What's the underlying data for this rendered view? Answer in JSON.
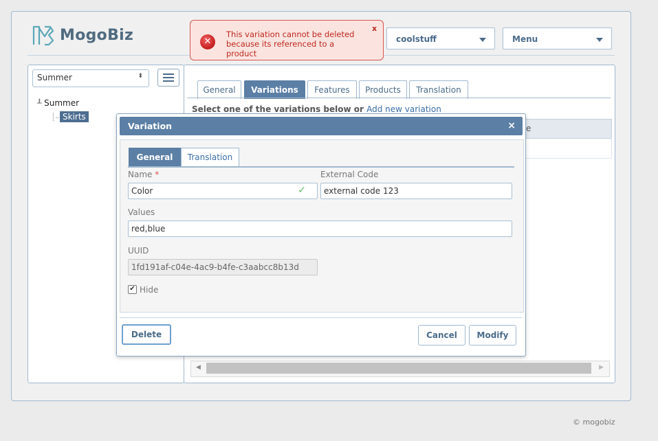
{
  "brand": {
    "name": "MogoBiz"
  },
  "alert": {
    "message": "This variation cannot be deleted because its referenced to a product",
    "close": "x"
  },
  "header": {
    "store_select": "coolstuff",
    "menu_select": "Menu"
  },
  "sidebar": {
    "category_select": "Summer",
    "tree": {
      "root": "Summer",
      "child": "Skirts"
    }
  },
  "main": {
    "tabs": [
      {
        "label": "General"
      },
      {
        "label": "Variations",
        "active": true
      },
      {
        "label": "Features"
      },
      {
        "label": "Products"
      },
      {
        "label": "Translation"
      }
    ],
    "instruction": "Select one of the variations below or ",
    "add_link": "Add new variation",
    "grid_header_partial": "e"
  },
  "dialog": {
    "title": "Variation",
    "close": "×",
    "tabs": [
      {
        "label": "General",
        "active": true
      },
      {
        "label": "Translation"
      }
    ],
    "fields": {
      "name_label": "Name",
      "name_required": "*",
      "name_value": "Color",
      "external_code_label": "External Code",
      "external_code_value": "external code 123",
      "values_label": "Values",
      "values_value": "red,blue",
      "uuid_label": "UUID",
      "uuid_value": "1fd191af-c04e-4ac9-b4fe-c3aabcc8b13d",
      "hide_label": "Hide",
      "hide_checked": true
    },
    "buttons": {
      "delete": "Delete",
      "cancel": "Cancel",
      "modify": "Modify"
    }
  },
  "footer": {
    "copyright": "© mogobiz"
  },
  "colors": {
    "accent": "#5b7fa5",
    "error_text": "#c0281e",
    "error_bg": "#fbe4e0",
    "valid_check": "#5cb85c",
    "selection": "#4d6e91"
  }
}
